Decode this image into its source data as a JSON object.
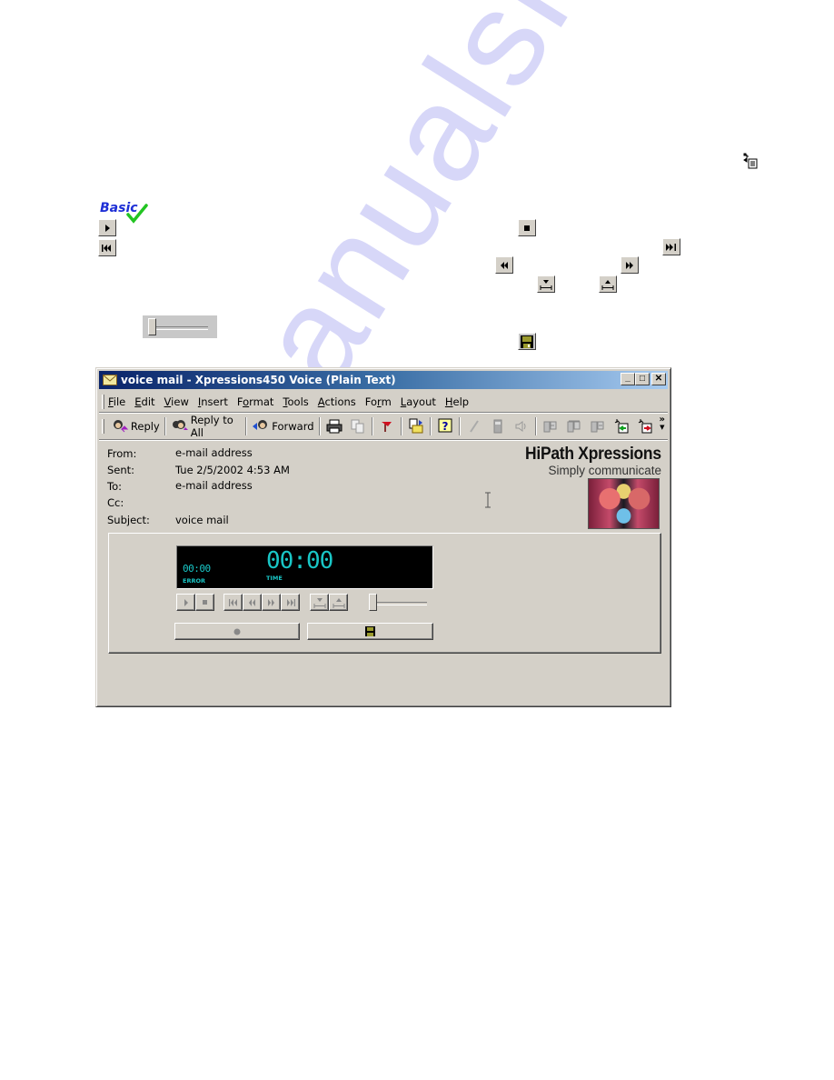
{
  "legend": {
    "basic_logo_text": "Basic",
    "icons": [
      {
        "name": "play",
        "glyph": "play-icon"
      },
      {
        "name": "stop",
        "glyph": "stop-icon"
      },
      {
        "name": "skip-to-start",
        "glyph": "skip-start-icon"
      },
      {
        "name": "skip-to-end",
        "glyph": "skip-end-icon"
      },
      {
        "name": "rewind",
        "glyph": "rewind-icon"
      },
      {
        "name": "fast-forward",
        "glyph": "fast-forward-icon"
      },
      {
        "name": "insert-down",
        "glyph": "insert-down-icon"
      },
      {
        "name": "insert-up",
        "glyph": "insert-up-icon"
      },
      {
        "name": "volume-slider",
        "glyph": "slider-icon"
      },
      {
        "name": "save",
        "glyph": "floppy-disk-icon"
      },
      {
        "name": "forward-message",
        "glyph": "forward-message-icon"
      }
    ]
  },
  "window": {
    "title": "voice mail - Xpressions450 Voice (Plain Text)",
    "caption_buttons": {
      "minimize": "_",
      "maximize": "□",
      "close": "✕"
    },
    "menu": [
      {
        "label": "File",
        "accel": "F"
      },
      {
        "label": "Edit",
        "accel": "E"
      },
      {
        "label": "View",
        "accel": "V"
      },
      {
        "label": "Insert",
        "accel": "I"
      },
      {
        "label": "Format",
        "accel": "o"
      },
      {
        "label": "Tools",
        "accel": "T"
      },
      {
        "label": "Actions",
        "accel": "A"
      },
      {
        "label": "Form",
        "accel": "r"
      },
      {
        "label": "Layout",
        "accel": "L"
      },
      {
        "label": "Help",
        "accel": "H"
      }
    ],
    "toolbar": {
      "reply": "Reply",
      "reply_all": "Reply to All",
      "forward": "Forward",
      "overflow": "»"
    },
    "header_fields": [
      {
        "label": "From:",
        "value": "e-mail address"
      },
      {
        "label": "Sent:",
        "value": "Tue 2/5/2002 4:53 AM"
      },
      {
        "label": "To:",
        "value": "e-mail address"
      },
      {
        "label": "Cc:",
        "value": ""
      },
      {
        "label": "Subject:",
        "value": "voice mail"
      }
    ],
    "brand": {
      "name": "HiPath Xpressions",
      "tagline": "Simply communicate"
    },
    "player": {
      "small_time": "00:00",
      "status": "ERROR",
      "big_time": "00:00",
      "time_label": "TIME",
      "volume": 0,
      "colors": {
        "lcd_bg": "#000000",
        "lcd_fg": "#19c6c6"
      }
    }
  },
  "watermark": "manualslib.com"
}
